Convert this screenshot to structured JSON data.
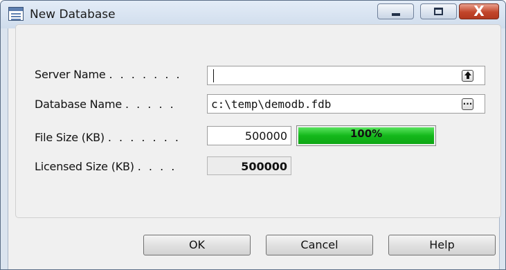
{
  "window": {
    "title": "New Database",
    "close_glyph": "X"
  },
  "form": {
    "server_name": {
      "label": "Server Name",
      "dots": ". . . . . . .",
      "value": ""
    },
    "database_name": {
      "label": "Database Name",
      "dots": ". . . . .",
      "value": "c:\\temp\\demodb.fdb",
      "browse_glyph": "..."
    },
    "file_size": {
      "label": "File Size (KB)",
      "dots": ". . . . . . .",
      "value": "500000",
      "progress_label": "100%",
      "progress_fraction": 1.0
    },
    "licensed_size": {
      "label": "Licensed Size (KB)",
      "dots": ". . . .",
      "value": "500000"
    }
  },
  "buttons": {
    "ok": "OK",
    "cancel": "Cancel",
    "help": "Help"
  },
  "icons": {
    "title": "database-window-icon",
    "server_lookup": "up-arrow-icon",
    "browse": "ellipsis-icon"
  },
  "colors": {
    "progress_fill": "#14b81b",
    "close_button": "#c2452a"
  }
}
